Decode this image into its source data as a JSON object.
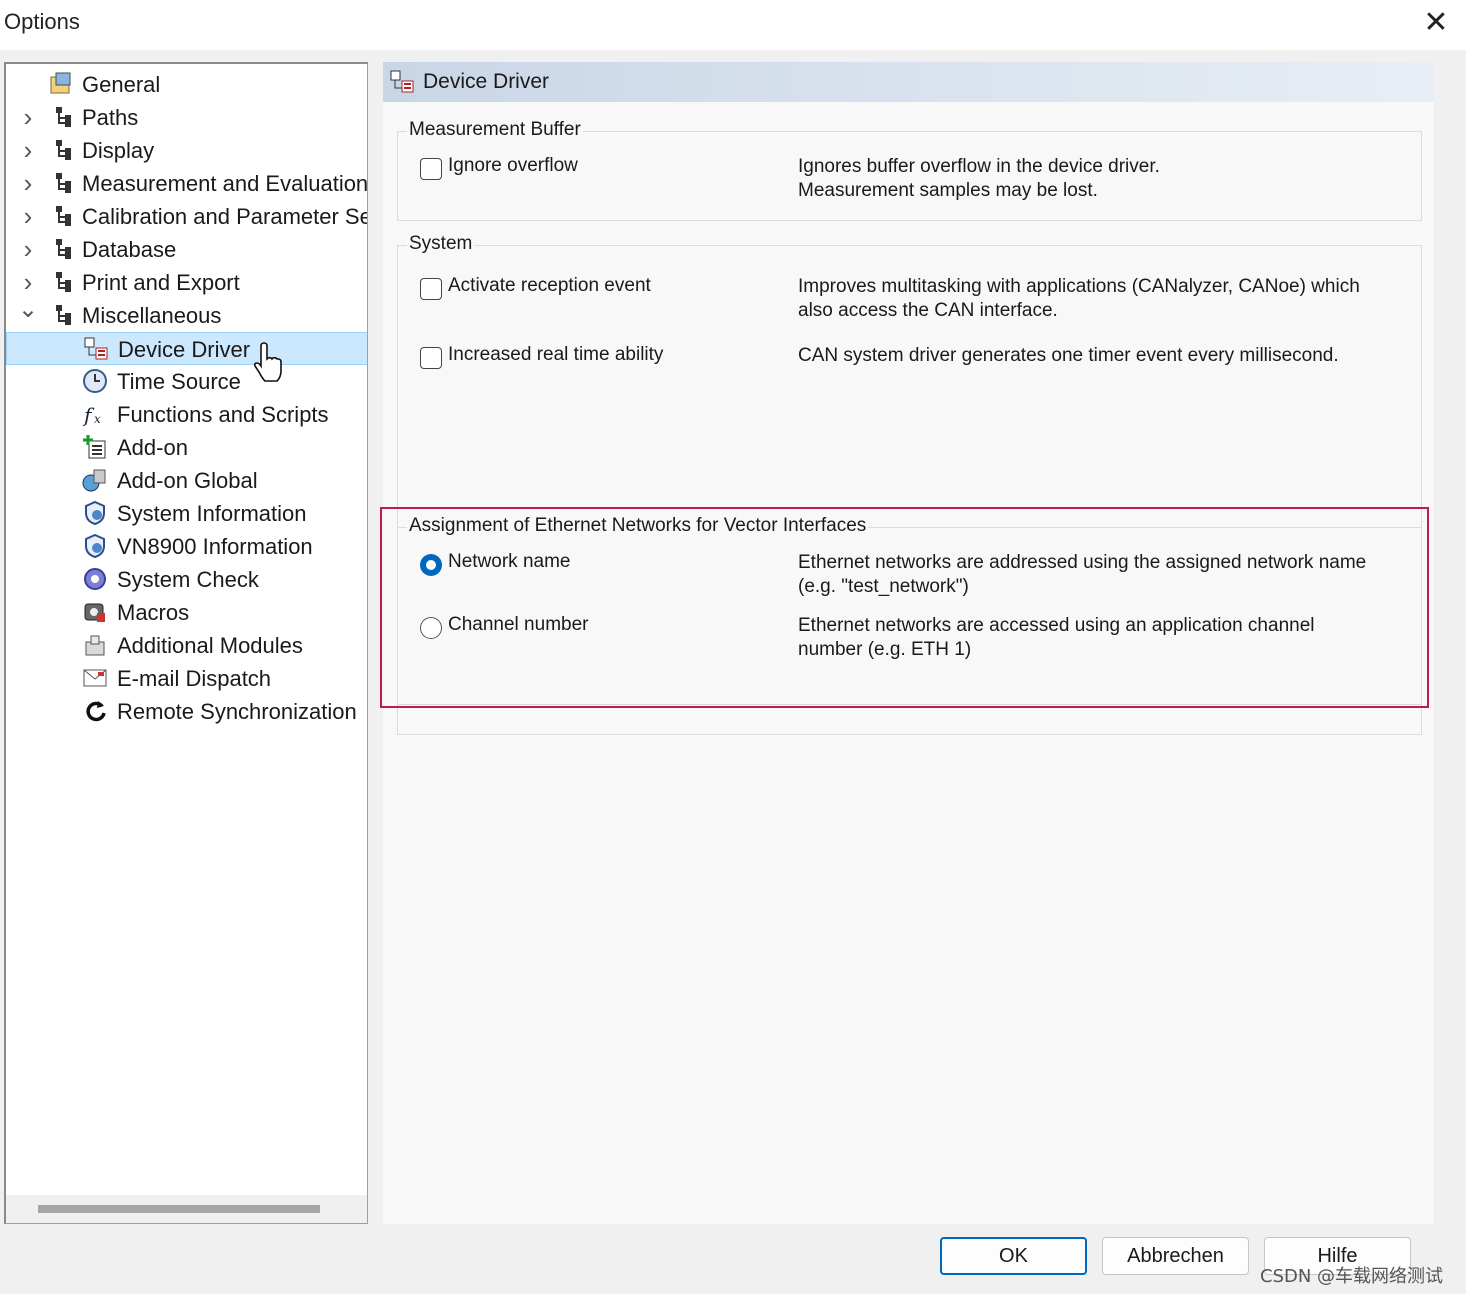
{
  "window": {
    "title": "Options",
    "close_glyph": "✕"
  },
  "tree": {
    "items": [
      {
        "label": "General",
        "icon": "general-settings-icon",
        "expandable": false
      },
      {
        "label": "Paths",
        "icon": "tree-node-icon",
        "expandable": true
      },
      {
        "label": "Display",
        "icon": "tree-node-icon",
        "expandable": true
      },
      {
        "label": "Measurement and Evaluation",
        "icon": "tree-node-icon",
        "expandable": true
      },
      {
        "label": "Calibration and Parameter Se",
        "icon": "tree-node-icon",
        "expandable": true
      },
      {
        "label": "Database",
        "icon": "tree-node-icon",
        "expandable": true
      },
      {
        "label": "Print and Export",
        "icon": "tree-node-icon",
        "expandable": true
      },
      {
        "label": "Miscellaneous",
        "icon": "tree-node-icon",
        "expanded": true
      },
      {
        "label": "Device Driver",
        "icon": "device-driver-icon",
        "selected": true
      },
      {
        "label": "Time Source",
        "icon": "clock-icon"
      },
      {
        "label": "Functions and Scripts",
        "icon": "function-icon"
      },
      {
        "label": "Add-on",
        "icon": "add-on-icon"
      },
      {
        "label": "Add-on Global",
        "icon": "add-on-global-icon"
      },
      {
        "label": "System Information",
        "icon": "system-information-icon"
      },
      {
        "label": "VN8900 Information",
        "icon": "vn8900-information-icon"
      },
      {
        "label": "System Check",
        "icon": "system-check-icon"
      },
      {
        "label": "Macros",
        "icon": "macros-icon"
      },
      {
        "label": "Additional Modules",
        "icon": "additional-modules-icon"
      },
      {
        "label": "E-mail Dispatch",
        "icon": "email-icon"
      },
      {
        "label": "Remote Synchronization",
        "icon": "sync-icon"
      }
    ]
  },
  "content": {
    "header_title": "Device Driver",
    "measurement_buffer": {
      "title": "Measurement Buffer",
      "ignore_overflow_label": "Ignore overflow",
      "ignore_overflow_checked": false,
      "ignore_overflow_desc_1": "Ignores buffer overflow in the device driver.",
      "ignore_overflow_desc_2": "Measurement samples may be lost."
    },
    "system": {
      "title": "System",
      "reception_label": "Activate reception event",
      "reception_checked": false,
      "reception_desc_1": "Improves multitasking with applications (CANalyzer, CANoe) which",
      "reception_desc_2": "also access the CAN interface.",
      "realtime_label": "Increased real time ability",
      "realtime_checked": false,
      "realtime_desc": "CAN system driver generates one timer event every millisecond."
    },
    "ethernet": {
      "title": "Assignment of Ethernet Networks for Vector Interfaces",
      "network_name_label": "Network name",
      "network_name_selected": true,
      "network_name_desc_1": "Ethernet networks are addressed using the assigned network name",
      "network_name_desc_2": "(e.g. \"test_network\")",
      "channel_label": "Channel number",
      "channel_selected": false,
      "channel_desc_1": "Ethernet networks are accessed using an application channel",
      "channel_desc_2": "number (e.g. ETH 1)"
    }
  },
  "buttons": {
    "ok": "OK",
    "cancel": "Abbrechen",
    "help": "Hilfe"
  },
  "watermark": "CSDN @车载网络测试",
  "colors": {
    "highlight": "#c2185b",
    "selection": "#cce8ff",
    "accent": "#0067c0"
  }
}
